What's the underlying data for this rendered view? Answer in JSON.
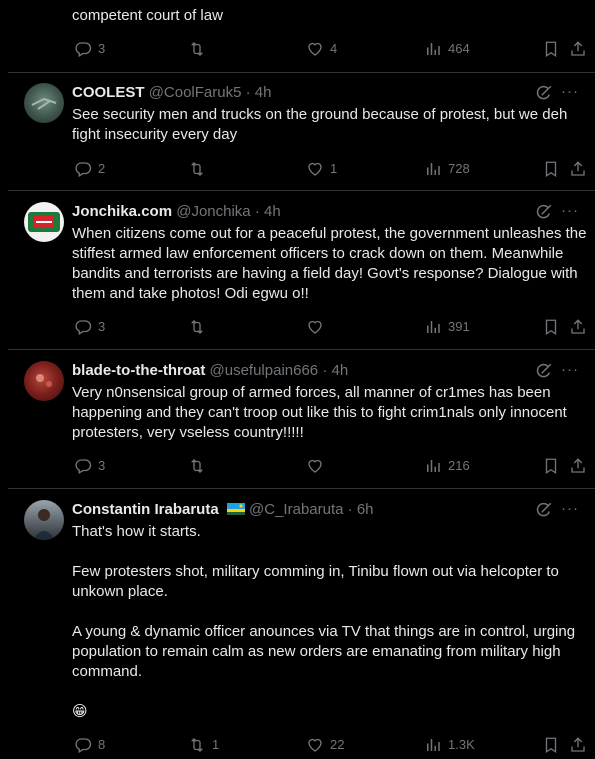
{
  "tweets": [
    {
      "body": "competent court of law",
      "replies": "3",
      "reposts": "",
      "likes": "4",
      "views": "464"
    },
    {
      "name": "COOLEST",
      "handle": "@CoolFaruk5",
      "time": "4h",
      "body": "See security men and trucks on the ground because of protest, but we deh fight insecurity every day",
      "replies": "2",
      "reposts": "",
      "likes": "1",
      "views": "728"
    },
    {
      "name": "Jonchika.com",
      "handle": "@Jonchika",
      "time": "4h",
      "body": "When citizens come out for a peaceful protest, the government unleashes the stiffest armed law enforcement officers to crack down on them. Meanwhile bandits and terrorists are having a field day! Govt's response? Dialogue with them and take photos! Odi egwu o!!",
      "replies": "3",
      "reposts": "",
      "likes": "",
      "views": "391"
    },
    {
      "name": "blade-to-the-throat",
      "handle": "@usefulpain666",
      "time": "4h",
      "body": "Very n0nsensical group of armed forces, all manner of cr1mes has been happening and they can't troop out like this to fight crim1nals only innocent protesters, very vseless country!!!!!",
      "replies": "3",
      "reposts": "",
      "likes": "",
      "views": "216"
    },
    {
      "name": "Constantin Irabaruta",
      "handle": "@C_Irabaruta",
      "time": "6h",
      "body": "That's how it starts.\n\nFew protesters shot, military comming in, Tinibu flown out via helcopter to unkown place.\n\nA young & dynamic officer anounces via TV that things are in control, urging population to remain calm as new orders are emanating from military high command.\n\n😁",
      "replies": "8",
      "reposts": "1",
      "likes": "22",
      "views": "1.3K"
    }
  ],
  "separator": "·",
  "colors": {
    "bg": "#000000",
    "text": "#e7e9ea",
    "muted": "#71767b",
    "divider": "#2f3336"
  }
}
